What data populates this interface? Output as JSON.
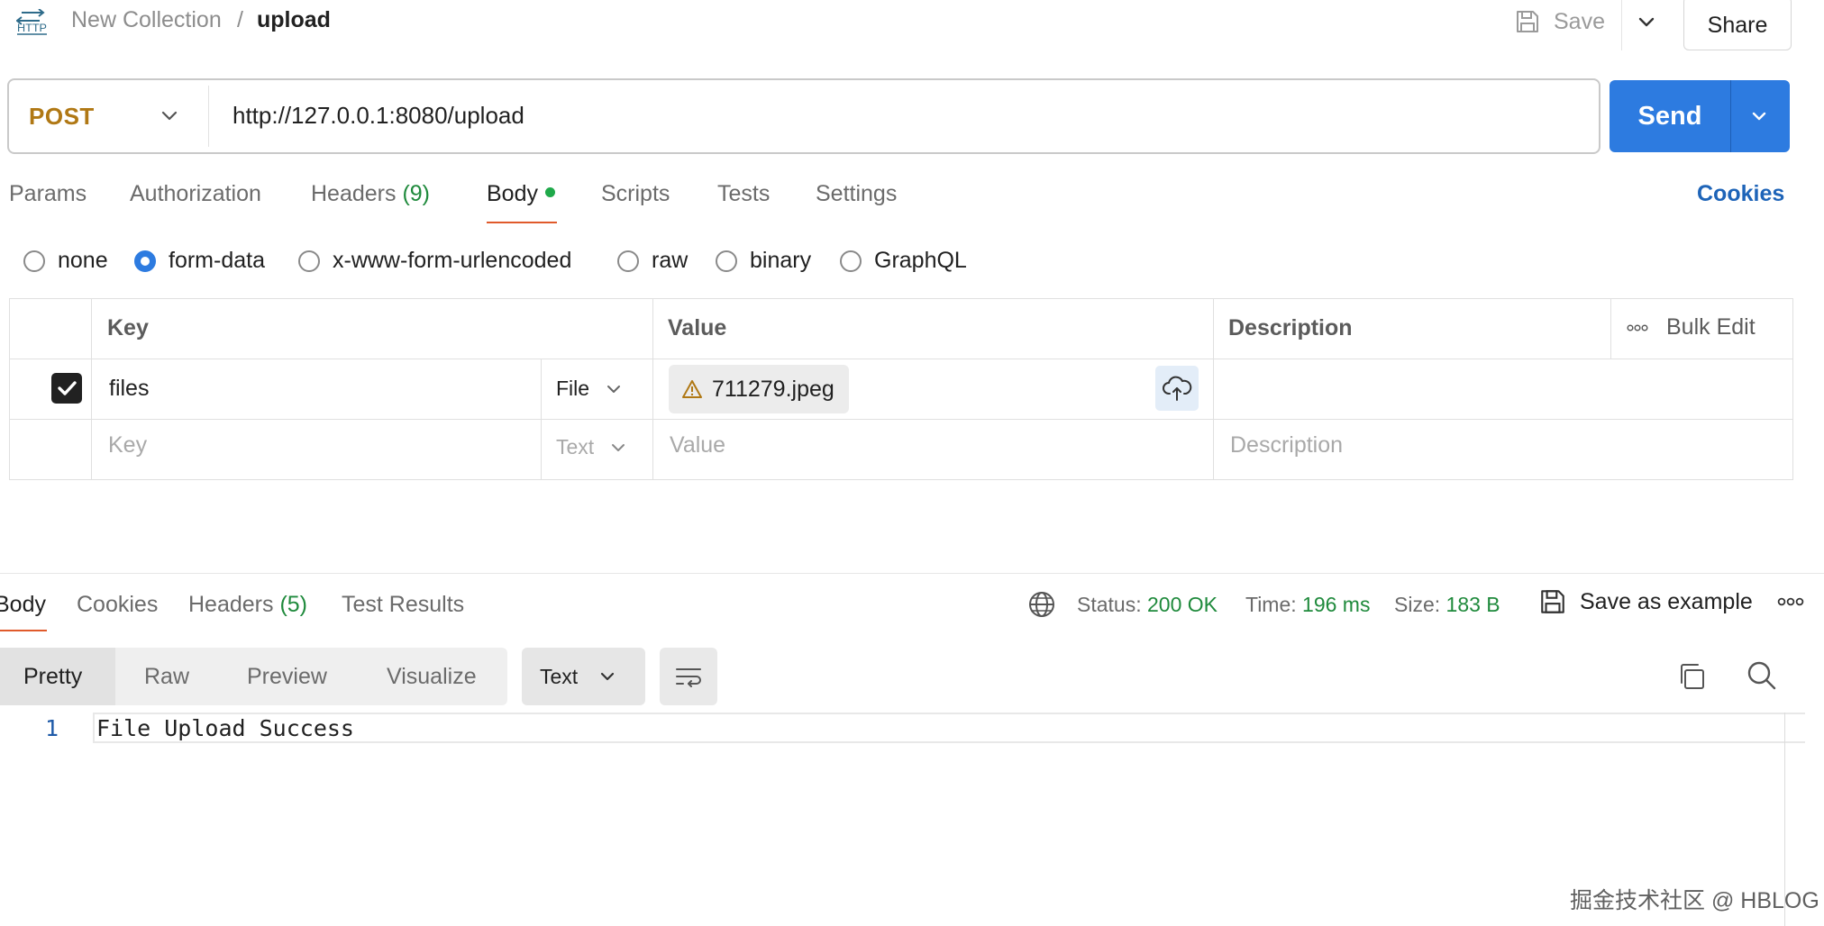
{
  "breadcrumb": {
    "collection": "New Collection",
    "separator": "/",
    "request": "upload"
  },
  "toolbar": {
    "save_label": "Save",
    "share_label": "Share"
  },
  "request": {
    "method": "POST",
    "url": "http://127.0.0.1:8080/upload",
    "send_label": "Send"
  },
  "request_tabs": {
    "params": "Params",
    "authorization": "Authorization",
    "headers": "Headers",
    "headers_count": "(9)",
    "body": "Body",
    "scripts": "Scripts",
    "tests": "Tests",
    "settings": "Settings",
    "cookies": "Cookies",
    "active": "Body"
  },
  "body_types": {
    "none": "none",
    "form_data": "form-data",
    "urlencoded": "x-www-form-urlencoded",
    "raw": "raw",
    "binary": "binary",
    "graphql": "GraphQL",
    "selected": "form-data"
  },
  "form_table": {
    "headers": {
      "key": "Key",
      "value": "Value",
      "description": "Description",
      "bulk_edit": "Bulk Edit"
    },
    "rows": [
      {
        "checked": true,
        "key": "files",
        "type": "File",
        "value": "711279.jpeg",
        "description": ""
      }
    ],
    "new_row": {
      "key_placeholder": "Key",
      "type": "Text",
      "value_placeholder": "Value",
      "description_placeholder": "Description"
    }
  },
  "response_tabs": {
    "body": "Body",
    "cookies": "Cookies",
    "headers": "Headers",
    "headers_count": "(5)",
    "test_results": "Test Results",
    "active": "Body"
  },
  "response_meta": {
    "status_label": "Status:",
    "status_value": "200 OK",
    "time_label": "Time:",
    "time_value": "196 ms",
    "size_label": "Size:",
    "size_value": "183 B",
    "save_example": "Save as example"
  },
  "response_view": {
    "pretty": "Pretty",
    "raw": "Raw",
    "preview": "Preview",
    "visualize": "Visualize",
    "format": "Text",
    "active": "Pretty"
  },
  "response_body": {
    "line_number": "1",
    "line_text": "File Upload Success"
  },
  "watermark": "掘金技术社区 @ HBLOG",
  "colors": {
    "accent": "#2d7be0",
    "method": "#b07814",
    "success": "#1f8a3c",
    "tab_underline": "#e05a2b"
  },
  "icons": [
    "http-icon",
    "save-icon",
    "chevron-down-icon",
    "checkbox-checked-icon",
    "warning-icon",
    "cloud-upload-icon",
    "globe-icon",
    "ellipsis-icon",
    "wrap-lines-icon",
    "copy-icon",
    "search-icon"
  ]
}
